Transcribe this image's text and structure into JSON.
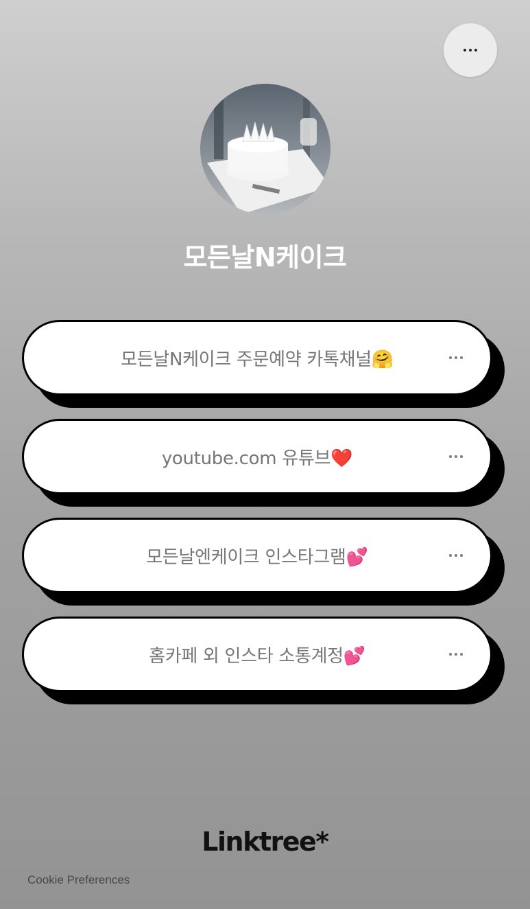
{
  "header": {
    "more_button_label": "more options"
  },
  "profile": {
    "name": "모든날N케이크",
    "avatar_alt": "cake photo"
  },
  "links": [
    {
      "label": "모든날N케이크 주문예약 카톡채널🤗"
    },
    {
      "label": "youtube.com 유튜브❤️"
    },
    {
      "label": "모든날엔케이크 인스타그램💕"
    },
    {
      "label": "홈카페 외 인스타 소통계정💕"
    }
  ],
  "footer": {
    "brand": "Linktree*",
    "cookie_preferences": "Cookie Preferences"
  }
}
